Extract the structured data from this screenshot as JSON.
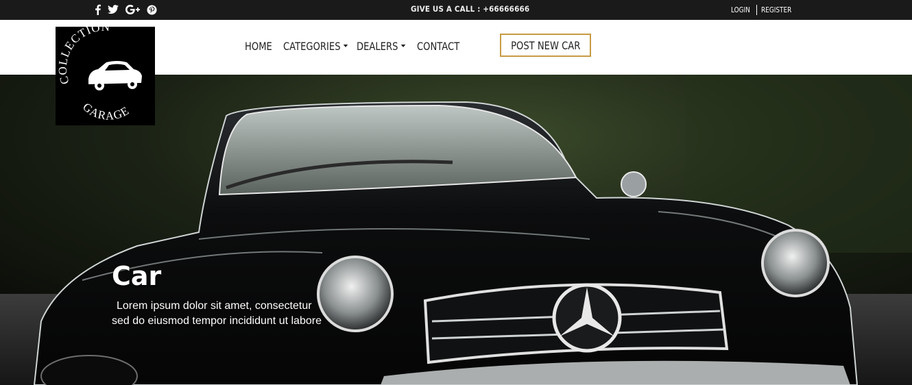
{
  "topbar": {
    "social": [
      {
        "icon": "facebook-icon"
      },
      {
        "icon": "twitter-icon"
      },
      {
        "icon": "google-plus-icon"
      },
      {
        "icon": "pinterest-icon"
      }
    ],
    "call_text": "GIVE US A CALL : +66666666",
    "login_label": "LOGIN",
    "register_label": "REGISTER"
  },
  "logo": {
    "top_text": "COLLECTION",
    "bottom_text": "GARAGE"
  },
  "nav": {
    "items": [
      {
        "label": "HOME",
        "dropdown": false
      },
      {
        "label": "CATEGORIES",
        "dropdown": true
      },
      {
        "label": "DEALERS",
        "dropdown": true
      },
      {
        "label": "CONTACT",
        "dropdown": false
      }
    ],
    "post_button": "POST NEW CAR"
  },
  "hero": {
    "title": "Car",
    "text_line1": "Lorem ipsum dolor sit amet, consectetur",
    "text_line2": "sed do eiusmod tempor incididunt ut labore"
  },
  "colors": {
    "topbar_bg": "#1a1a1a",
    "accent_border": "#c79a43",
    "nav_text": "#222222"
  }
}
